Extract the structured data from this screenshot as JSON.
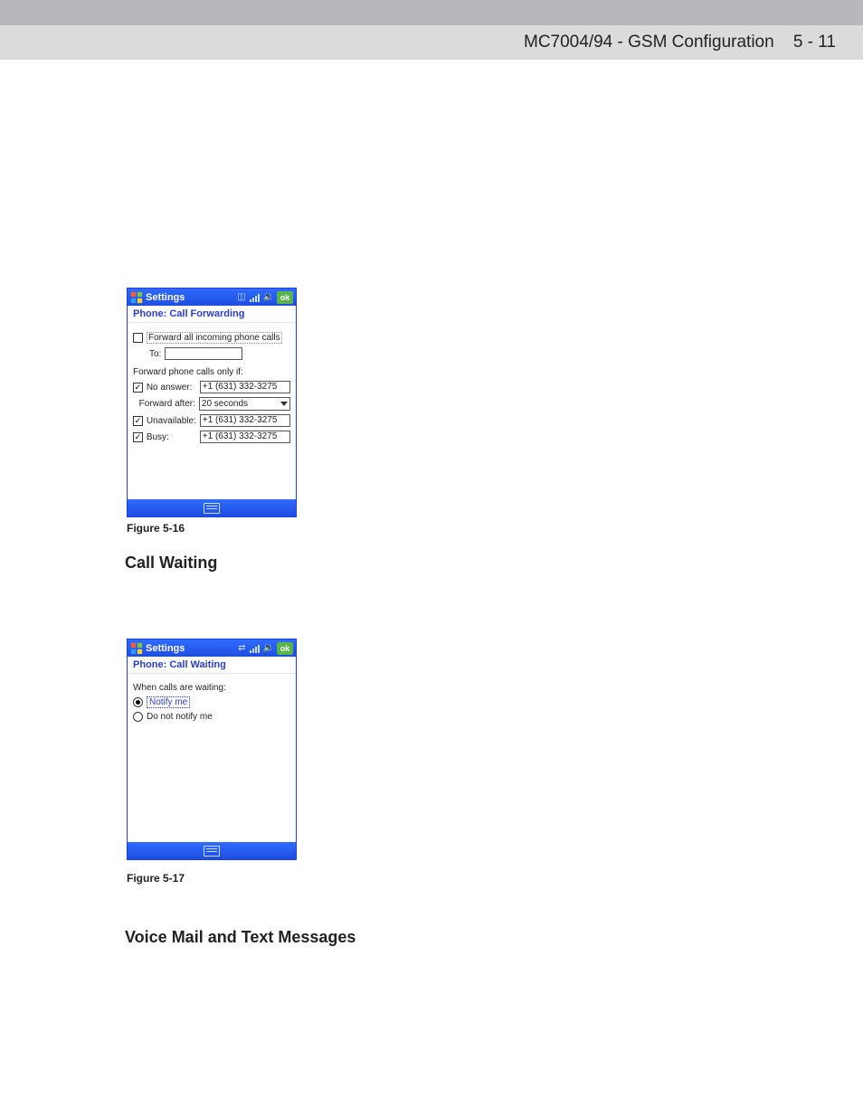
{
  "header": {
    "breadcrumb": "MC7004/94 - GSM Configuration",
    "page_no": "5 - 11"
  },
  "sections": {
    "call_waiting": "Call Waiting",
    "voicemail": "Voice Mail and Text Messages"
  },
  "captions": {
    "fig1": "Figure 5-16",
    "fig2": "Figure 5-17"
  },
  "device1": {
    "titlebar": {
      "title": "Settings",
      "ok": "ok"
    },
    "subtitle": "Phone: Call Forwarding",
    "forward_all_label": "Forward all incoming phone calls",
    "forward_all_checked": false,
    "to_label": "To:",
    "to_value": "",
    "only_if_label": "Forward phone calls only if:",
    "rows": {
      "no_answer": {
        "label": "No answer:",
        "checked": true,
        "value": "+1 (631) 332-3275"
      },
      "forward_after": {
        "label": "Forward after:",
        "value": "20 seconds"
      },
      "unavailable": {
        "label": "Unavailable:",
        "checked": true,
        "value": "+1 (631) 332-3275"
      },
      "busy": {
        "label": "Busy:",
        "checked": true,
        "value": "+1 (631) 332-3275"
      }
    }
  },
  "device2": {
    "titlebar": {
      "title": "Settings",
      "ok": "ok"
    },
    "subtitle": "Phone: Call Waiting",
    "prompt": "When calls are waiting:",
    "notify": {
      "label": "Notify me",
      "checked": true
    },
    "donot": {
      "label": "Do not notify me",
      "checked": false
    }
  }
}
